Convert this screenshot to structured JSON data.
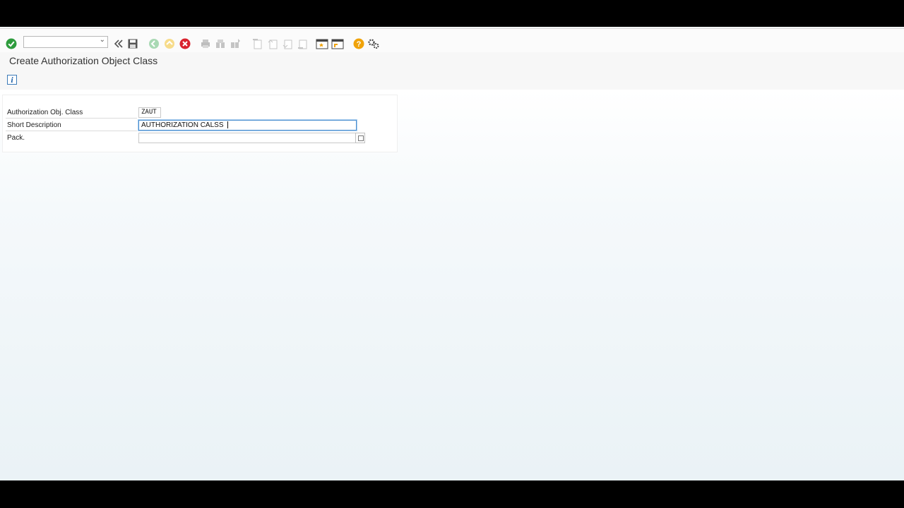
{
  "toolbar": {
    "command_field_value": "",
    "icons": [
      "enter-icon",
      "back-double-icon",
      "save-icon",
      "back-icon",
      "exit-icon",
      "cancel-icon",
      "print-icon",
      "find-icon",
      "find-next-icon",
      "first-page-icon",
      "previous-page-icon",
      "next-page-icon",
      "last-page-icon",
      "new-session-icon",
      "create-shortcut-icon",
      "help-icon",
      "settings-icon"
    ]
  },
  "page": {
    "title": "Create Authorization Object Class"
  },
  "form": {
    "class_label": "Authorization Obj. Class",
    "class_value": "ZAUT",
    "desc_label": "Short Description",
    "desc_value": "AUTHORIZATION CALSS ",
    "pack_label": "Pack.",
    "pack_value": ""
  },
  "colors": {
    "enter_green": "#2e9c3d",
    "cancel_red": "#d9232e",
    "help_orange": "#f0a30a",
    "accent_blue": "#1b5fa8"
  }
}
